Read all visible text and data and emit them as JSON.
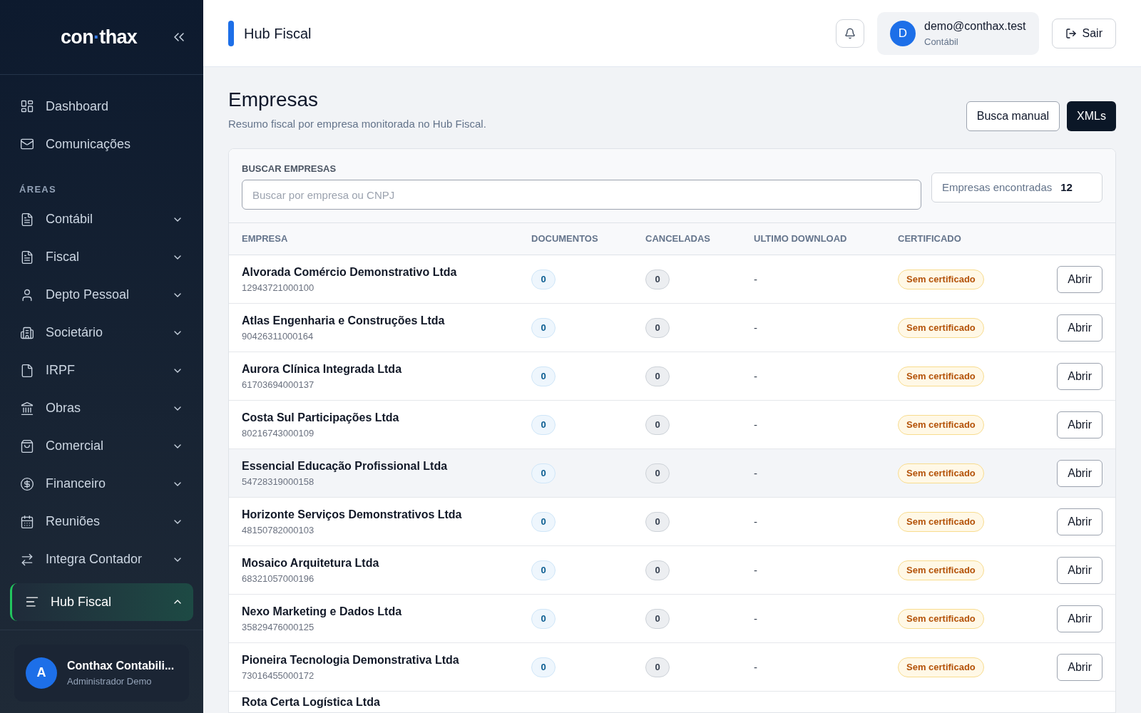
{
  "sidebar": {
    "logo": {
      "left": "con",
      "dot": "·",
      "right": "thax"
    },
    "top_items": [
      {
        "label": "Dashboard",
        "kind": "dashboard"
      },
      {
        "label": "Comunicações",
        "kind": "mail"
      }
    ],
    "section_title": "ÁREAS",
    "areas": [
      {
        "label": "Contábil",
        "kind": "doc",
        "expanded": false,
        "selected": false
      },
      {
        "label": "Fiscal",
        "kind": "doc",
        "expanded": false,
        "selected": false
      },
      {
        "label": "Depto Pessoal",
        "kind": "user",
        "expanded": false,
        "selected": false
      },
      {
        "label": "Societário",
        "kind": "building",
        "expanded": false,
        "selected": false
      },
      {
        "label": "IRPF",
        "kind": "file",
        "expanded": false,
        "selected": false
      },
      {
        "label": "Obras",
        "kind": "landmark",
        "expanded": false,
        "selected": false
      },
      {
        "label": "Comercial",
        "kind": "bag",
        "expanded": false,
        "selected": false
      },
      {
        "label": "Financeiro",
        "kind": "dollar",
        "expanded": false,
        "selected": false
      },
      {
        "label": "Reuniões",
        "kind": "calendar",
        "expanded": false,
        "selected": false
      },
      {
        "label": "Integra Contador",
        "kind": "arrows",
        "expanded": false,
        "selected": false
      },
      {
        "label": "Hub Fiscal",
        "kind": "lines",
        "expanded": true,
        "selected": true
      }
    ],
    "account": {
      "initial": "A",
      "name": "Conthax Contabili...",
      "role": "Administrador Demo"
    }
  },
  "header": {
    "title": "Hub Fiscal",
    "user": {
      "initial": "D",
      "email": "demo@conthax.test",
      "role": "Contábil"
    },
    "logout": "Sair"
  },
  "page": {
    "title": "Empresas",
    "subtitle": "Resumo fiscal por empresa monitorada no Hub Fiscal.",
    "buttons": [
      {
        "label": "Busca manual",
        "kind": "outline"
      },
      {
        "label": "XMLs",
        "kind": "primary"
      }
    ]
  },
  "search": {
    "label": "BUSCAR EMPRESAS",
    "placeholder": "Buscar por empresa ou CNPJ",
    "count_label": "Empresas encontradas",
    "count": "12"
  },
  "table": {
    "columns": [
      "EMPRESA",
      "DOCUMENTOS",
      "CANCELADAS",
      "ULTIMO DOWNLOAD",
      "CERTIFICADO"
    ],
    "rows": [
      {
        "name": "Alvorada Comércio Demonstrativo Ltda",
        "cnpj": "12943721000100",
        "documents": "0",
        "cancelled": "0",
        "last_download": "-",
        "certificate": "Sem certificado",
        "action": "Abrir",
        "highlighted": false
      },
      {
        "name": "Atlas Engenharia e Construções Ltda",
        "cnpj": "90426311000164",
        "documents": "0",
        "cancelled": "0",
        "last_download": "-",
        "certificate": "Sem certificado",
        "action": "Abrir",
        "highlighted": false
      },
      {
        "name": "Aurora Clínica Integrada Ltda",
        "cnpj": "61703694000137",
        "documents": "0",
        "cancelled": "0",
        "last_download": "-",
        "certificate": "Sem certificado",
        "action": "Abrir",
        "highlighted": false
      },
      {
        "name": "Costa Sul Participações Ltda",
        "cnpj": "80216743000109",
        "documents": "0",
        "cancelled": "0",
        "last_download": "-",
        "certificate": "Sem certificado",
        "action": "Abrir",
        "highlighted": false
      },
      {
        "name": "Essencial Educação Profissional Ltda",
        "cnpj": "54728319000158",
        "documents": "0",
        "cancelled": "0",
        "last_download": "-",
        "certificate": "Sem certificado",
        "action": "Abrir",
        "highlighted": true
      },
      {
        "name": "Horizonte Serviços Demonstrativos Ltda",
        "cnpj": "48150782000103",
        "documents": "0",
        "cancelled": "0",
        "last_download": "-",
        "certificate": "Sem certificado",
        "action": "Abrir",
        "highlighted": false
      },
      {
        "name": "Mosaico Arquitetura Ltda",
        "cnpj": "68321057000196",
        "documents": "0",
        "cancelled": "0",
        "last_download": "-",
        "certificate": "Sem certificado",
        "action": "Abrir",
        "highlighted": false
      },
      {
        "name": "Nexo Marketing e Dados Ltda",
        "cnpj": "35829476000125",
        "documents": "0",
        "cancelled": "0",
        "last_download": "-",
        "certificate": "Sem certificado",
        "action": "Abrir",
        "highlighted": false
      },
      {
        "name": "Pioneira Tecnologia Demonstrativa Ltda",
        "cnpj": "73016455000172",
        "documents": "0",
        "cancelled": "0",
        "last_download": "-",
        "certificate": "Sem certificado",
        "action": "Abrir",
        "highlighted": false
      },
      {
        "name": "Rota Certa Logística Ltda",
        "highlighted": false
      }
    ]
  }
}
